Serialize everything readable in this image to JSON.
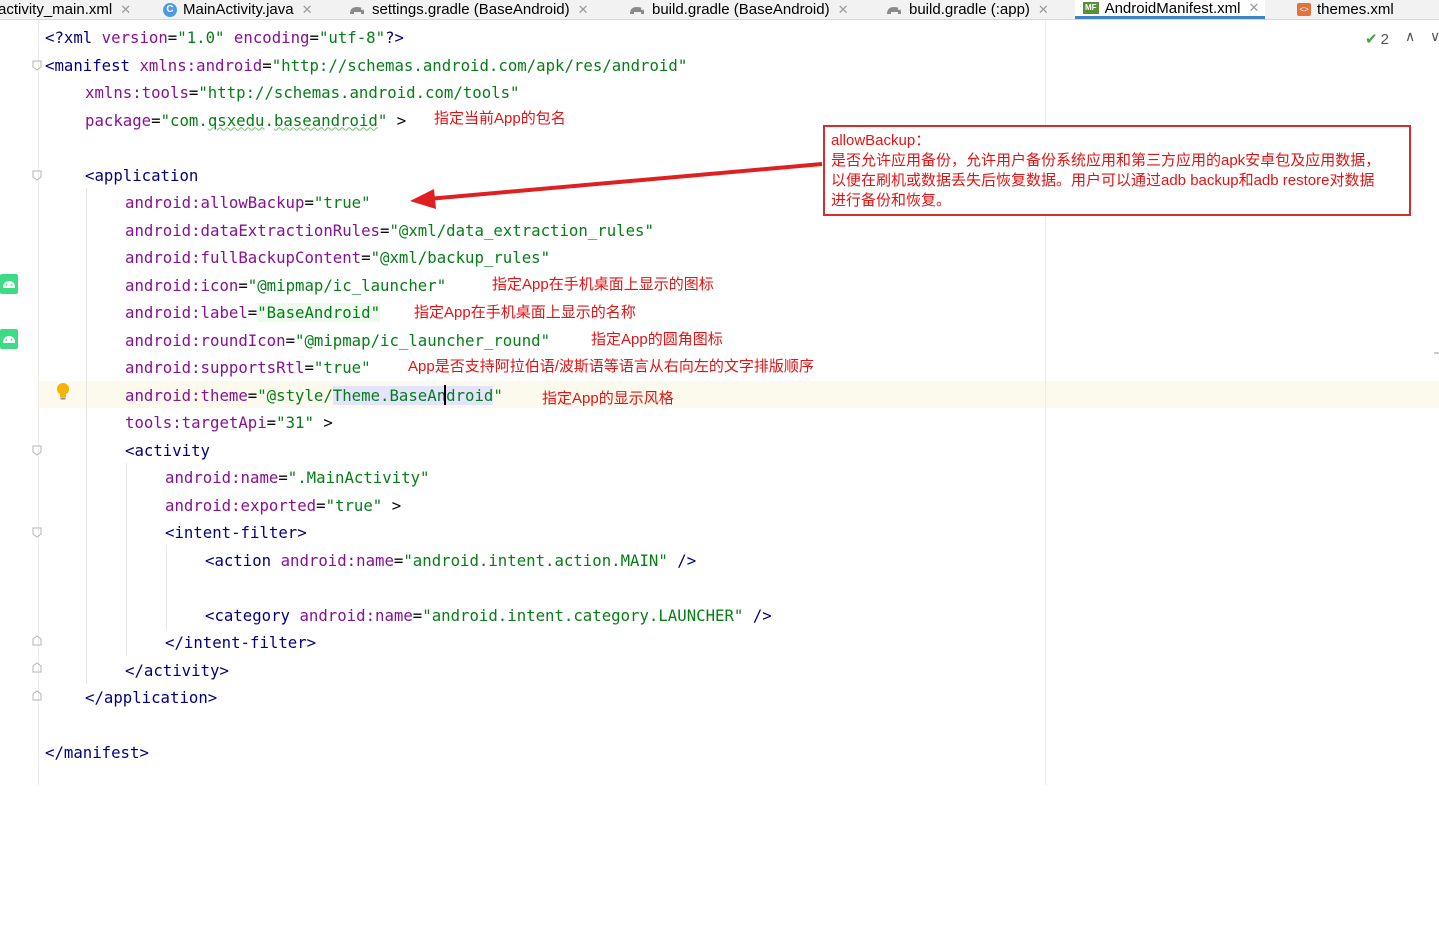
{
  "tabs": [
    {
      "label": "activity_main.xml",
      "icon": "none",
      "active": false
    },
    {
      "label": "MainActivity.java",
      "icon": "java-class-icon",
      "active": false
    },
    {
      "label": "settings.gradle (BaseAndroid)",
      "icon": "gradle-icon",
      "active": false
    },
    {
      "label": "build.gradle (BaseAndroid)",
      "icon": "gradle-icon",
      "active": false
    },
    {
      "label": "build.gradle (:app)",
      "icon": "gradle-icon",
      "active": false
    },
    {
      "label": "AndroidManifest.xml",
      "icon": "manifest-icon",
      "active": true
    },
    {
      "label": "themes.xml",
      "icon": "xml-icon",
      "active": false
    }
  ],
  "tab_icons": {
    "java": "C",
    "manifest": "MF",
    "xml": "<>"
  },
  "inspections": {
    "count": "2"
  },
  "code": {
    "l1": {
      "a": "<?xml",
      "b": " version",
      "c": "=",
      "d": "\"1.0\"",
      "e": " encoding",
      "f": "=",
      "g": "\"utf-8\"",
      "h": "?>"
    },
    "l2": {
      "a": "<manifest",
      "b": " xmlns:android",
      "c": "=",
      "d": "\"http://schemas.android.com/apk/res/android\""
    },
    "l3": {
      "b": "xmlns:tools",
      "c": "=",
      "d": "\"http://schemas.android.com/tools\""
    },
    "l4": {
      "b": "package",
      "c": "=",
      "d1": "\"com.",
      "d2": "qsxedu",
      "d3": ".",
      "d4": "baseandroid",
      "d5": "\"",
      "e": " >"
    },
    "l6": {
      "a": "<application"
    },
    "l7": {
      "b": "android:allowBackup",
      "c": "=",
      "d": "\"true\""
    },
    "l8": {
      "b": "android:dataExtractionRules",
      "c": "=",
      "d": "\"@xml/data_extraction_rules\""
    },
    "l9": {
      "b": "android:fullBackupContent",
      "c": "=",
      "d": "\"@xml/backup_rules\""
    },
    "l10": {
      "b": "android:icon",
      "c": "=",
      "d": "\"@mipmap/ic_launcher\""
    },
    "l11": {
      "b": "android:label",
      "c": "=",
      "d": "\"BaseAndroid\""
    },
    "l12": {
      "b": "android:roundIcon",
      "c": "=",
      "d": "\"@mipmap/ic_launcher_round\""
    },
    "l13": {
      "b": "android:supportsRtl",
      "c": "=",
      "d": "\"true\""
    },
    "l14": {
      "b": "android:theme",
      "c": "=",
      "d1": "\"@style/",
      "d2": "Theme.BaseAndroid",
      "d3": "\""
    },
    "l15": {
      "b": "tools:targetApi",
      "c": "=",
      "d": "\"31\"",
      "e": " >"
    },
    "l16": {
      "a": "<activity"
    },
    "l17": {
      "b": "android:name",
      "c": "=",
      "d": "\".MainActivity\""
    },
    "l18": {
      "b": "android:exported",
      "c": "=",
      "d": "\"true\"",
      "e": " >"
    },
    "l19": {
      "a": "<intent-filter",
      "e": ">"
    },
    "l20": {
      "a": "<action",
      "b": " android:name",
      "c": "=",
      "d": "\"android.intent.action.MAIN\"",
      "e": " />"
    },
    "l22": {
      "a": "<category",
      "b": " android:name",
      "c": "=",
      "d": "\"android.intent.category.LAUNCHER\"",
      "e": " />"
    },
    "l23": {
      "a": "</intent-filter>"
    },
    "l24": {
      "a": "</activity>"
    },
    "l25": {
      "a": "</application>"
    },
    "l27": {
      "a": "</manifest>"
    }
  },
  "annotations": {
    "package": "指定当前App的包名",
    "icon": "指定App在手机桌面上显示的图标",
    "label": "指定App在手机桌面上显示的名称",
    "round_icon": "指定App的圆角图标",
    "supports_rtl": "App是否支持阿拉伯语/波斯语等语言从右向左的文字排版顺序",
    "theme": "指定App的显示风格"
  },
  "callout": {
    "title": "allowBackup：",
    "line1": "是否允许应用备份，允许用户备份系统应用和第三方应用的apk安卓包及应用数据，",
    "line2": "以便在刷机或数据丢失后恢复数据。用户可以通过adb backup和adb restore对数据",
    "line3": "进行备份和恢复。"
  },
  "colors": {
    "accent": "#4083c9",
    "tag": "#000080",
    "attribute": "#871094",
    "value": "#067d17",
    "annotation": "#e01414"
  }
}
